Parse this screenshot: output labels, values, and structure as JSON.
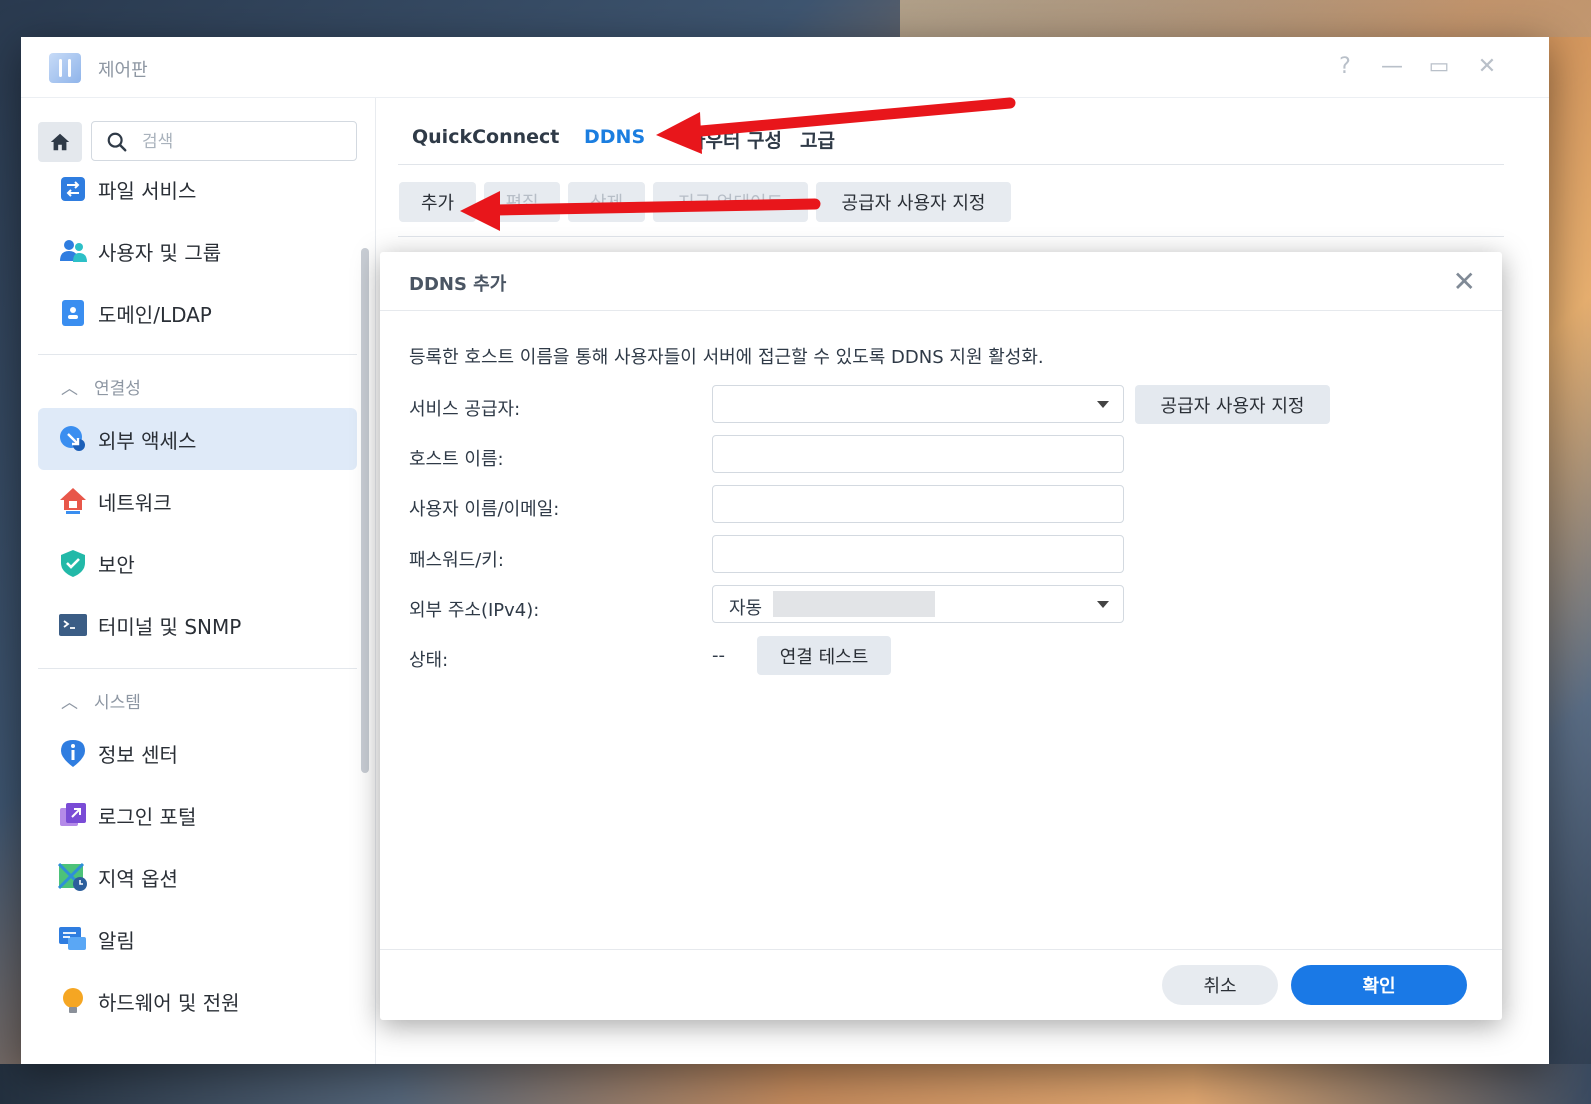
{
  "window": {
    "title": "제어판",
    "controls": {
      "help": "?",
      "minimize": "—",
      "maximize": "▭",
      "close": "✕"
    }
  },
  "sidebar": {
    "search_placeholder": "검색",
    "items_top": [
      {
        "label": "파일 서비스",
        "icon": "file-services-icon"
      },
      {
        "label": "사용자 및 그룹",
        "icon": "users-groups-icon"
      },
      {
        "label": "도메인/LDAP",
        "icon": "domain-ldap-icon"
      }
    ],
    "section_connectivity": "연결성",
    "items_connectivity": [
      {
        "label": "외부 액세스",
        "icon": "external-access-icon",
        "active": true
      },
      {
        "label": "네트워크",
        "icon": "network-icon"
      },
      {
        "label": "보안",
        "icon": "security-shield-icon"
      },
      {
        "label": "터미널 및 SNMP",
        "icon": "terminal-icon"
      }
    ],
    "section_system": "시스템",
    "items_system": [
      {
        "label": "정보 센터",
        "icon": "info-center-icon"
      },
      {
        "label": "로그인 포털",
        "icon": "login-portal-icon"
      },
      {
        "label": "지역 옵션",
        "icon": "regional-options-icon"
      },
      {
        "label": "알림",
        "icon": "notification-icon"
      },
      {
        "label": "하드웨어 및 전원",
        "icon": "hardware-power-icon"
      }
    ]
  },
  "tabs": [
    {
      "label": "QuickConnect"
    },
    {
      "label": "DDNS",
      "active": true
    },
    {
      "label": "라우터 구성"
    },
    {
      "label": "고급"
    }
  ],
  "toolbar": {
    "add": "추가",
    "edit": "편집",
    "delete": "삭제",
    "update_now": "지금 업데이트",
    "customize_provider": "공급자 사용자 지정"
  },
  "dialog": {
    "title": "DDNS 추가",
    "description": "등록한 호스트 이름을 통해 사용자들이 서버에 접근할 수 있도록 DDNS 지원 활성화.",
    "fields": {
      "provider_label": "서비스 공급자:",
      "provider_value": "",
      "hostname_label": "호스트 이름:",
      "username_label": "사용자 이름/이메일:",
      "password_label": "패스워드/키:",
      "external_label": "외부 주소(IPv4):",
      "external_value": "자동",
      "status_label": "상태:",
      "status_value": "--"
    },
    "customize_provider_button": "공급자 사용자 지정",
    "test_connection_button": "연결 테스트",
    "cancel": "취소",
    "ok": "확인"
  },
  "colors": {
    "accent": "#1a79e6",
    "active_tab": "#1b7ee0",
    "annotation_arrow": "#e8161b",
    "sidebar_active_bg": "#dfeaf8"
  }
}
